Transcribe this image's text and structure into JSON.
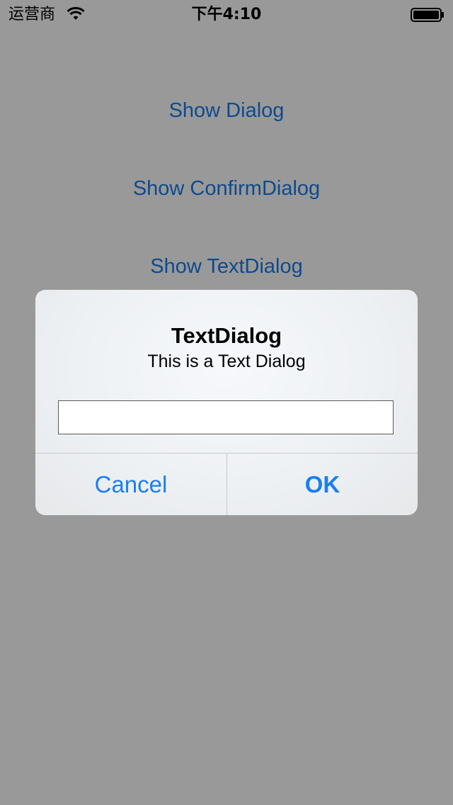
{
  "status_bar": {
    "carrier": "运营商",
    "time": "下午4:10"
  },
  "buttons": {
    "show_dialog": "Show Dialog",
    "show_confirm_dialog": "Show ConfirmDialog",
    "show_text_dialog": "Show TextDialog"
  },
  "dialog": {
    "title": "TextDialog",
    "message": "This is a Text Dialog",
    "input_value": "",
    "input_placeholder": "",
    "cancel_label": "Cancel",
    "ok_label": "OK"
  },
  "colors": {
    "background": "#999999",
    "link": "#0d4a8e",
    "dialog_button": "#1a7ff0"
  },
  "icons": {
    "wifi": "wifi-icon",
    "battery": "battery-icon"
  }
}
